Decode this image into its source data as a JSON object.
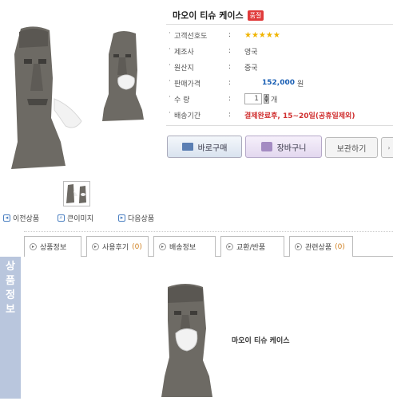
{
  "product": {
    "title": "마오이 티슈 케이스",
    "badge": "품절"
  },
  "info_rows": [
    {
      "label": "고객선호도",
      "colon": ":",
      "value": "★★★★★"
    },
    {
      "label": "제조사",
      "colon": ":",
      "value": "영국"
    },
    {
      "label": "원산지",
      "colon": ":",
      "value": "중국"
    },
    {
      "label": "판매가격",
      "colon": ":",
      "value": "152,000",
      "unit": "원"
    },
    {
      "label": "수 량",
      "colon": ":",
      "value": "1",
      "unit": "개"
    },
    {
      "label": "배송기간",
      "colon": ":",
      "value": "결제완료후, 15~20일(공휴일제외)"
    }
  ],
  "buttons": {
    "buy": "바로구매",
    "cart": "장바구니",
    "keep": "보관하기"
  },
  "nav": {
    "prev": "이전상품",
    "large": "큰이미지",
    "next": "다음상품"
  },
  "tabs": [
    {
      "label": "상품정보",
      "count": ""
    },
    {
      "label": "사용후기",
      "count": "(0)"
    },
    {
      "label": "배송정보",
      "count": ""
    },
    {
      "label": "교환/반품",
      "count": ""
    },
    {
      "label": "관련상품",
      "count": "(0)"
    }
  ],
  "sidebar": {
    "c1": "상",
    "c2": "품",
    "c3": "정",
    "c4": "보"
  },
  "detail": {
    "caption": "마오이 티슈 케이스"
  },
  "colors": {
    "star": "#f0b400",
    "price": "#1a5fb4",
    "ship": "#d03030",
    "badge": "#e03a3a",
    "sidebar": "#b9c6dd"
  }
}
